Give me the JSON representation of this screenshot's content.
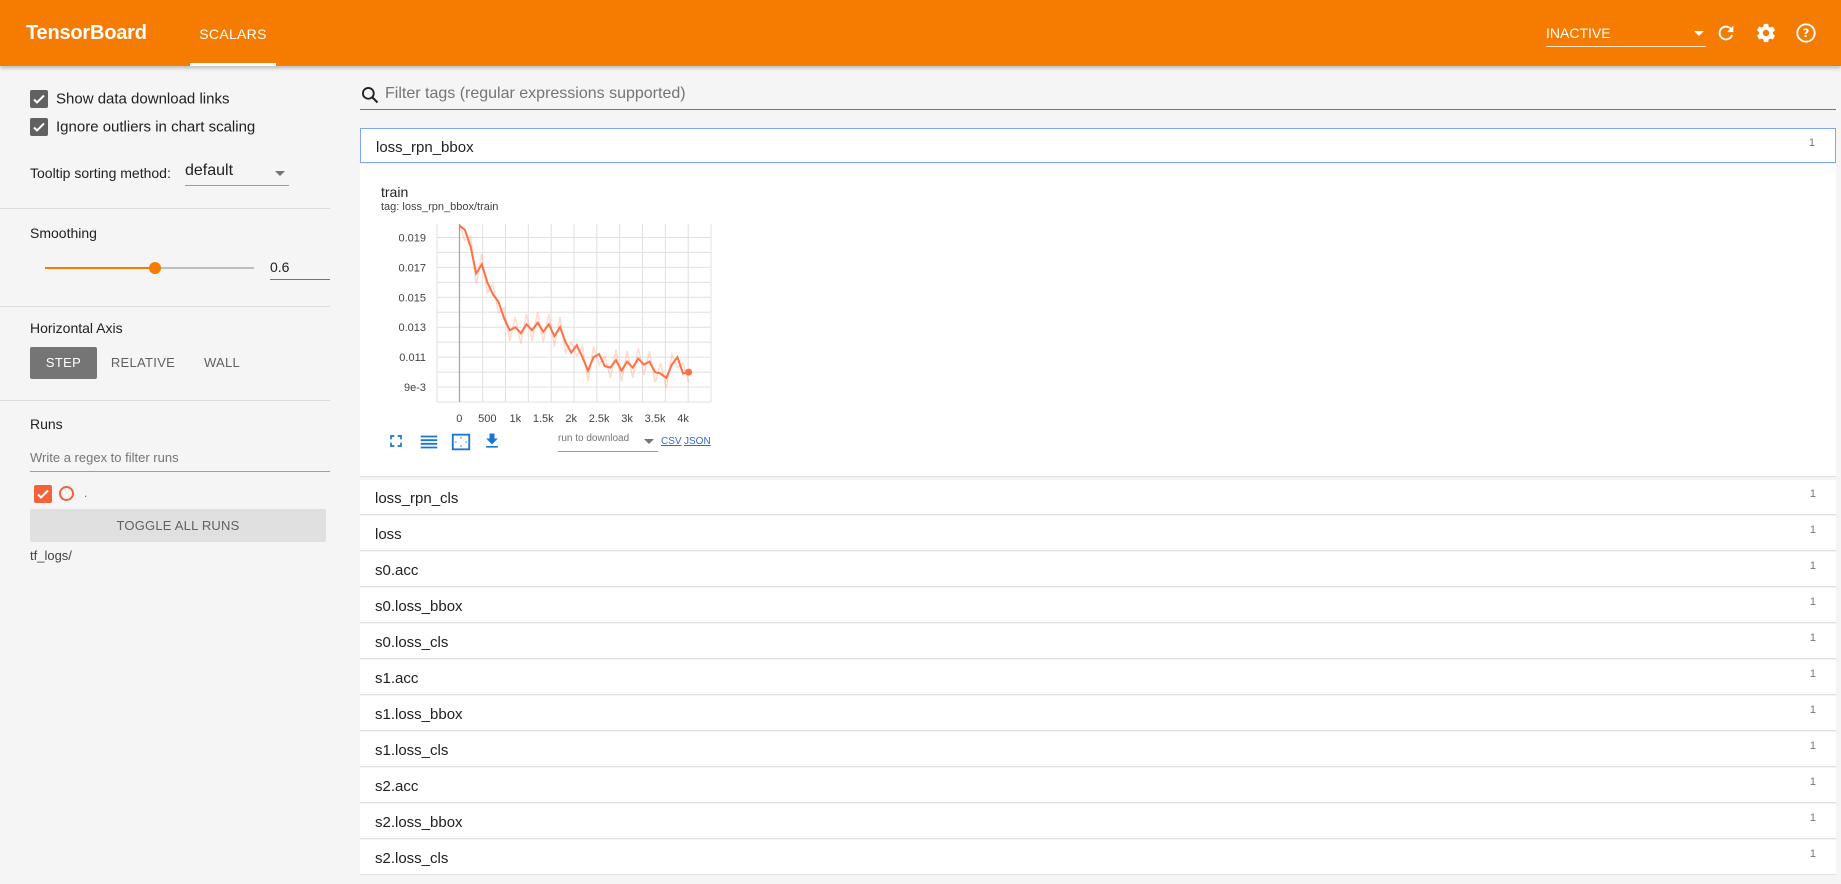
{
  "app": {
    "title": "TensorBoard",
    "tabs": [
      "SCALARS"
    ],
    "run_select": "INACTIVE",
    "accent": "#f57c00",
    "icons": [
      "refresh-icon",
      "settings-icon",
      "help-icon"
    ]
  },
  "sidebar": {
    "show_download_links": {
      "label": "Show data download links",
      "checked": true
    },
    "ignore_outliers": {
      "label": "Ignore outliers in chart scaling",
      "checked": true
    },
    "tooltip_label": "Tooltip sorting method:",
    "tooltip_value": "default",
    "smoothing_label": "Smoothing",
    "smoothing_value": "0.6",
    "horizontal_axis_label": "Horizontal Axis",
    "axis_buttons": [
      "STEP",
      "RELATIVE",
      "WALL"
    ],
    "axis_active": "STEP",
    "runs_label": "Runs",
    "runs_filter_placeholder": "Write a regex to filter runs",
    "run_name": ".",
    "run_color": "#f4623a",
    "toggle_all": "TOGGLE ALL RUNS",
    "logdir": "tf_logs/"
  },
  "main": {
    "filter_placeholder": "Filter tags (regular expressions supported)",
    "open_category": {
      "name": "loss_rpn_bbox",
      "count": "1"
    },
    "card": {
      "title": "train",
      "tag": "tag: loss_rpn_bbox/train",
      "download_select": "run to download",
      "csv": "CSV",
      "json": "JSON"
    },
    "categories": [
      {
        "name": "loss_rpn_cls",
        "count": "1"
      },
      {
        "name": "loss",
        "count": "1"
      },
      {
        "name": "s0.acc",
        "count": "1"
      },
      {
        "name": "s0.loss_bbox",
        "count": "1"
      },
      {
        "name": "s0.loss_cls",
        "count": "1"
      },
      {
        "name": "s1.acc",
        "count": "1"
      },
      {
        "name": "s1.loss_bbox",
        "count": "1"
      },
      {
        "name": "s1.loss_cls",
        "count": "1"
      },
      {
        "name": "s2.acc",
        "count": "1"
      },
      {
        "name": "s2.loss_bbox",
        "count": "1"
      },
      {
        "name": "s2.loss_cls",
        "count": "1"
      }
    ]
  },
  "chart_data": {
    "type": "line",
    "title": "train",
    "xlabel": "",
    "ylabel": "",
    "x_ticks": [
      "0",
      "500",
      "1k",
      "1.5k",
      "2k",
      "2.5k",
      "3k",
      "3.5k",
      "4k"
    ],
    "y_ticks": [
      "9e-3",
      "0.011",
      "0.013",
      "0.015",
      "0.017",
      "0.019"
    ],
    "xlim": [
      -400,
      4500
    ],
    "ylim": [
      0.008,
      0.0199
    ],
    "grid": true,
    "series": [
      {
        "color": "#ff7043",
        "x": [
          0,
          100,
          200,
          300,
          400,
          500,
          600,
          700,
          800,
          900,
          1000,
          1100,
          1200,
          1300,
          1400,
          1500,
          1600,
          1700,
          1800,
          1900,
          2000,
          2100,
          2200,
          2300,
          2400,
          2500,
          2600,
          2700,
          2800,
          2900,
          3000,
          3100,
          3200,
          3300,
          3400,
          3500,
          3600,
          3700,
          3800,
          3900,
          4000,
          4100
        ],
        "y": [
          0.0198,
          0.0195,
          0.0184,
          0.0166,
          0.0172,
          0.016,
          0.0152,
          0.0147,
          0.0136,
          0.0128,
          0.013,
          0.0126,
          0.0132,
          0.0128,
          0.0133,
          0.0127,
          0.0132,
          0.0124,
          0.013,
          0.012,
          0.0113,
          0.0118,
          0.011,
          0.0101,
          0.011,
          0.0112,
          0.0104,
          0.0103,
          0.0108,
          0.0101,
          0.0107,
          0.0103,
          0.0109,
          0.0105,
          0.0107,
          0.01,
          0.0099,
          0.0096,
          0.0105,
          0.011,
          0.0099,
          0.01
        ]
      }
    ]
  }
}
